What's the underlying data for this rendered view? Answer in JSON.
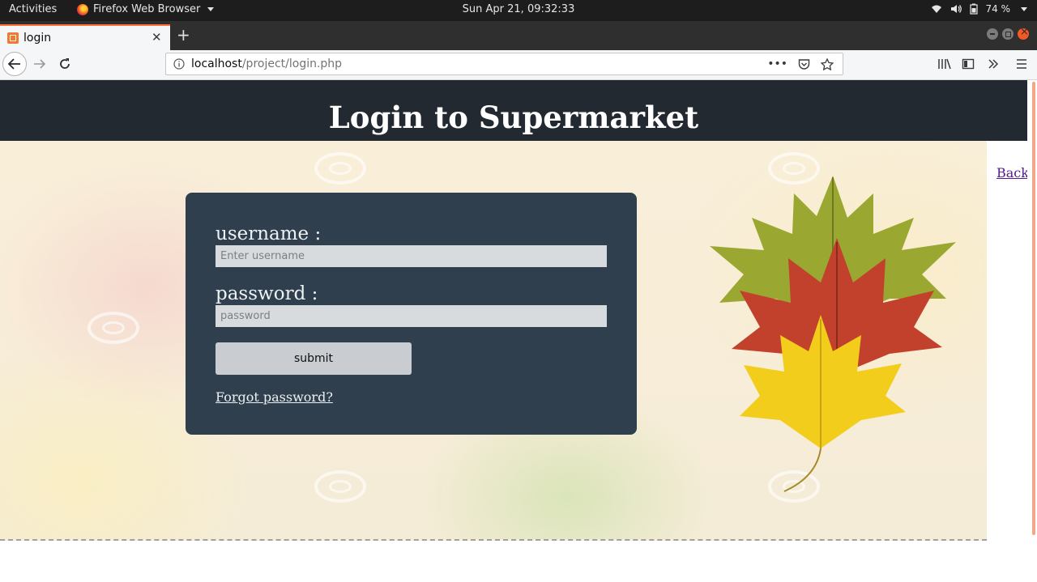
{
  "system_bar": {
    "activities": "Activities",
    "app_name": "Firefox Web Browser",
    "clock": "Sun Apr 21, 09:32:33",
    "battery": "74 %"
  },
  "browser": {
    "tab_title": "login",
    "url_host": "localhost",
    "url_path": "/project/login.php",
    "accent_color": "#ff7139"
  },
  "page": {
    "heading": "Login to Supermarket",
    "back_link": "Back",
    "form": {
      "username_label": "username :",
      "username_placeholder": "Enter username",
      "username_value": "",
      "password_label": "password :",
      "password_placeholder": "password",
      "password_value": "",
      "submit_label": "submit",
      "forgot_link": "Forgot password?"
    },
    "colors": {
      "header_bg": "#232931",
      "form_bg": "#2f3f4d",
      "link": "#551a8b"
    }
  }
}
